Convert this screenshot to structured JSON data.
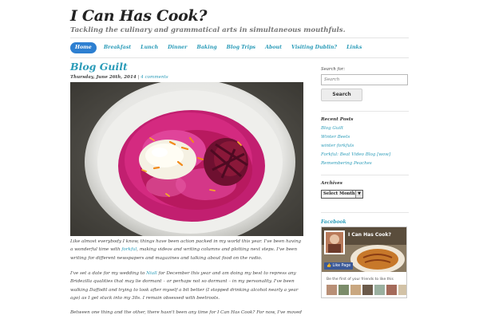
{
  "site": {
    "title": "I Can Has Cook?",
    "tagline": "Tackling the culinary and grammatical arts in simultaneous mouthfuls."
  },
  "nav": {
    "items": [
      "Home",
      "Breakfast",
      "Lunch",
      "Dinner",
      "Baking",
      "Blog Trips",
      "About",
      "Visiting Dublin?",
      "Links"
    ],
    "active": "Home"
  },
  "post": {
    "title": "Blog Guilt",
    "date": "Thursday, June 26th, 2014",
    "separator": "|",
    "comments": "4 comments",
    "p1": {
      "a": "Like almost everybody I know, things have been action packed in my world this year. I've been having a wonderful time with ",
      "link": "forkful",
      "b": ", making videos and writing columns and plotting next steps. I've been writing for different newspapers and magazines and talking about food on the radio."
    },
    "p2": {
      "a": "I've set a date for my wedding to ",
      "link": "Niall",
      "b": " for December this year and am doing my best to repress any Bridezilla qualities that may lie dormant – or perhaps not so dormant – in my personality. I've been walking Daffodil and trying to look after myself a bit better (I stopped drinking alcohol nearly a year ago) as I get stuck into my 30s. I remain obsessed with beetroots."
    },
    "p3": "Between one thing and the other, there hasn't been any time for I Can Has Cook? For now, I've moved"
  },
  "sidebar": {
    "search_label": "Search for:",
    "search_placeholder": "Search",
    "search_button": "Search",
    "recent_title": "Recent Posts",
    "recent_posts": [
      "Blog Guilt",
      "Winter Beets",
      "winter forkfuls",
      "Forkful: Beat Video Blog [wow]",
      "Remembering Peaches"
    ],
    "archives_title": "Archives",
    "archives_selected": "Select Month",
    "facebook_title": "Facebook",
    "fb_page_name": "I Can Has Cook?",
    "fb_like": "Like Page",
    "fb_text": "Be the first of your friends to like this"
  },
  "colors": {
    "accent": "#2a9bb8",
    "nav_active_bg": "#2d7fd1",
    "text": "#444444",
    "facebook_blue": "#3b5998"
  }
}
